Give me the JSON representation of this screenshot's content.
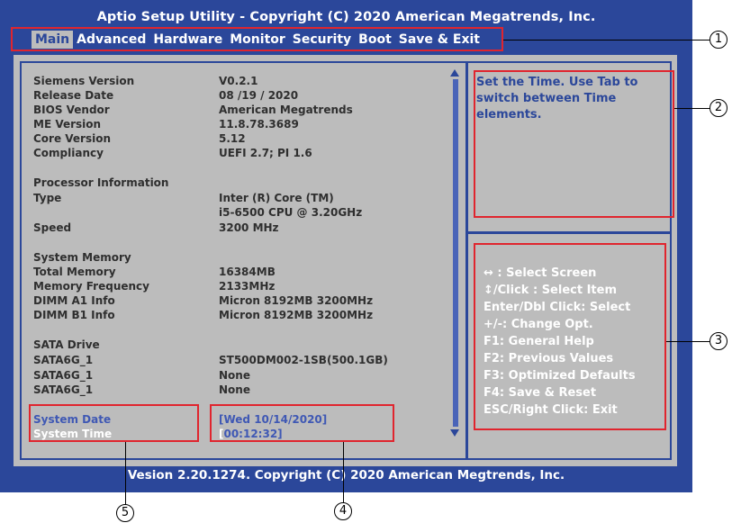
{
  "window": {
    "title": "Aptio Setup Utility - Copyright  (C)  2020  American Megatrends, Inc.",
    "footer": "Vesion 2.20.1274. Copyright (C) 2020  American Megtrends, Inc."
  },
  "menu": {
    "tabs": [
      "Main",
      "Advanced",
      "Hardware",
      "Monitor",
      "Security",
      "Boot",
      "Save & Exit"
    ],
    "active": "Main"
  },
  "info": {
    "rows": [
      {
        "label": "Siemens Version",
        "value": "V0.2.1"
      },
      {
        "label": "Release Date",
        "value": "08 /19 / 2020"
      },
      {
        "label": "BIOS Vendor",
        "value": "American Megatrends"
      },
      {
        "label": "ME Version",
        "value": "11.8.78.3689"
      },
      {
        "label": "Core Version",
        "value": "5.12"
      },
      {
        "label": "Compliancy",
        "value": "UEFI 2.7; PI 1.6"
      },
      {
        "label": "Processor Information",
        "value": ""
      },
      {
        "label": "Type",
        "value": "Inter (R)  Core (TM)"
      },
      {
        "label": "",
        "value": "i5-6500 CPU  @  3.20GHz"
      },
      {
        "label": "Speed",
        "value": "3200 MHz"
      },
      {
        "label": "System Memory",
        "value": ""
      },
      {
        "label": "Total Memory",
        "value": "16384MB"
      },
      {
        "label": "Memory  Frequency",
        "value": "2133MHz"
      },
      {
        "label": "DIMM  A1 Info",
        "value": "Micron 8192MB 3200MHz"
      },
      {
        "label": "DIMM  B1 Info",
        "value": "Micron  8192MB 3200MHz"
      },
      {
        "label": "SATA Drive",
        "value": ""
      },
      {
        "label": "SATA6G_1",
        "value": "ST500DM002-1SB(500.1GB)"
      },
      {
        "label": "SATA6G_1",
        "value": "None"
      },
      {
        "label": "SATA6G_1",
        "value": "None"
      }
    ],
    "system_date_label": "System Date",
    "system_date_value": "[Wed 10/14/2020]",
    "system_time_label": "System Time",
    "system_time_value": "[00:12:32]"
  },
  "help": {
    "text": "Set the Time. Use Tab to switch between Time elements."
  },
  "keys": {
    "items": [
      "↔ : Select Screen",
      "↕/Click : Select Item",
      "Enter/Dbl Click: Select",
      "+/-: Change Opt.",
      "F1: General Help",
      "F2: Previous Values",
      "F3: Optimized Defaults",
      "F4: Save & Reset",
      "ESC/Right Click: Exit"
    ]
  },
  "callouts": [
    "1",
    "2",
    "3",
    "4",
    "5"
  ],
  "colors": {
    "frame": "#2b479a",
    "panel": "#bcbcbc",
    "annotation": "#e0252e"
  }
}
